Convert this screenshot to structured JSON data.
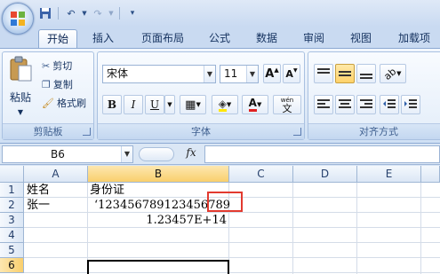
{
  "quick_access": {
    "icons": [
      "save-icon",
      "undo-icon",
      "redo-icon",
      "customize-icon"
    ]
  },
  "tabs": [
    {
      "label": "开始",
      "active": true
    },
    {
      "label": "插入"
    },
    {
      "label": "页面布局"
    },
    {
      "label": "公式"
    },
    {
      "label": "数据"
    },
    {
      "label": "审阅"
    },
    {
      "label": "视图"
    },
    {
      "label": "加载项"
    }
  ],
  "clipboard": {
    "paste_label": "粘贴",
    "cut_label": "剪切",
    "copy_label": "复制",
    "format_painter_label": "格式刷",
    "group_label": "剪贴板"
  },
  "font": {
    "font_name": "宋体",
    "font_size": "11",
    "grow_label": "A",
    "shrink_label": "A",
    "bold": "B",
    "italic": "I",
    "underline": "U",
    "font_color_label": "A",
    "phonetic_label": "wén",
    "phonetic_char": "文",
    "group_label": "字体"
  },
  "alignment": {
    "group_label": "对齐方式"
  },
  "formula_bar": {
    "name_box": "B6",
    "fx_label": "fx",
    "formula": ""
  },
  "sheet": {
    "columns": [
      "A",
      "B",
      "C",
      "D",
      "E"
    ],
    "rows": [
      "1",
      "2",
      "3",
      "4",
      "5",
      "6"
    ],
    "selected_column": "B",
    "selected_row": "6",
    "cells": {
      "A1": "姓名",
      "B1": "身份证",
      "A2": "张一",
      "B2": "‘123456789123456789",
      "B3": "1.23457E+14"
    }
  },
  "colors": {
    "ribbon": "#dbe7f6",
    "highlight": "#e23a2f",
    "selected_header": "#f9cf6d"
  }
}
